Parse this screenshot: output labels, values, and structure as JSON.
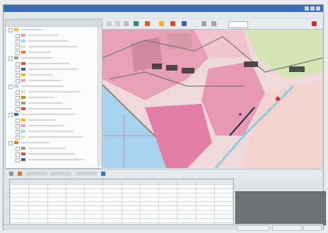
{
  "window": {
    "title": ""
  },
  "menu": {
    "items": []
  },
  "layer_panel": {
    "header": ""
  },
  "map_view": {
    "zoom": ""
  },
  "colors": {
    "titlebar": "#3a6fb8",
    "map_residential": "#e8a0b8",
    "map_water": "#a8d4ef",
    "map_park": "#d9e6b8",
    "map_road_blue": "#8fd0d8"
  },
  "icons": {
    "toolbar": [
      "pointer-icon",
      "pan-icon",
      "zoom-in-icon",
      "zoom-out-icon",
      "identify-icon",
      "measure-icon",
      "select-icon",
      "layer-icon",
      "print-icon",
      "help-icon"
    ]
  }
}
